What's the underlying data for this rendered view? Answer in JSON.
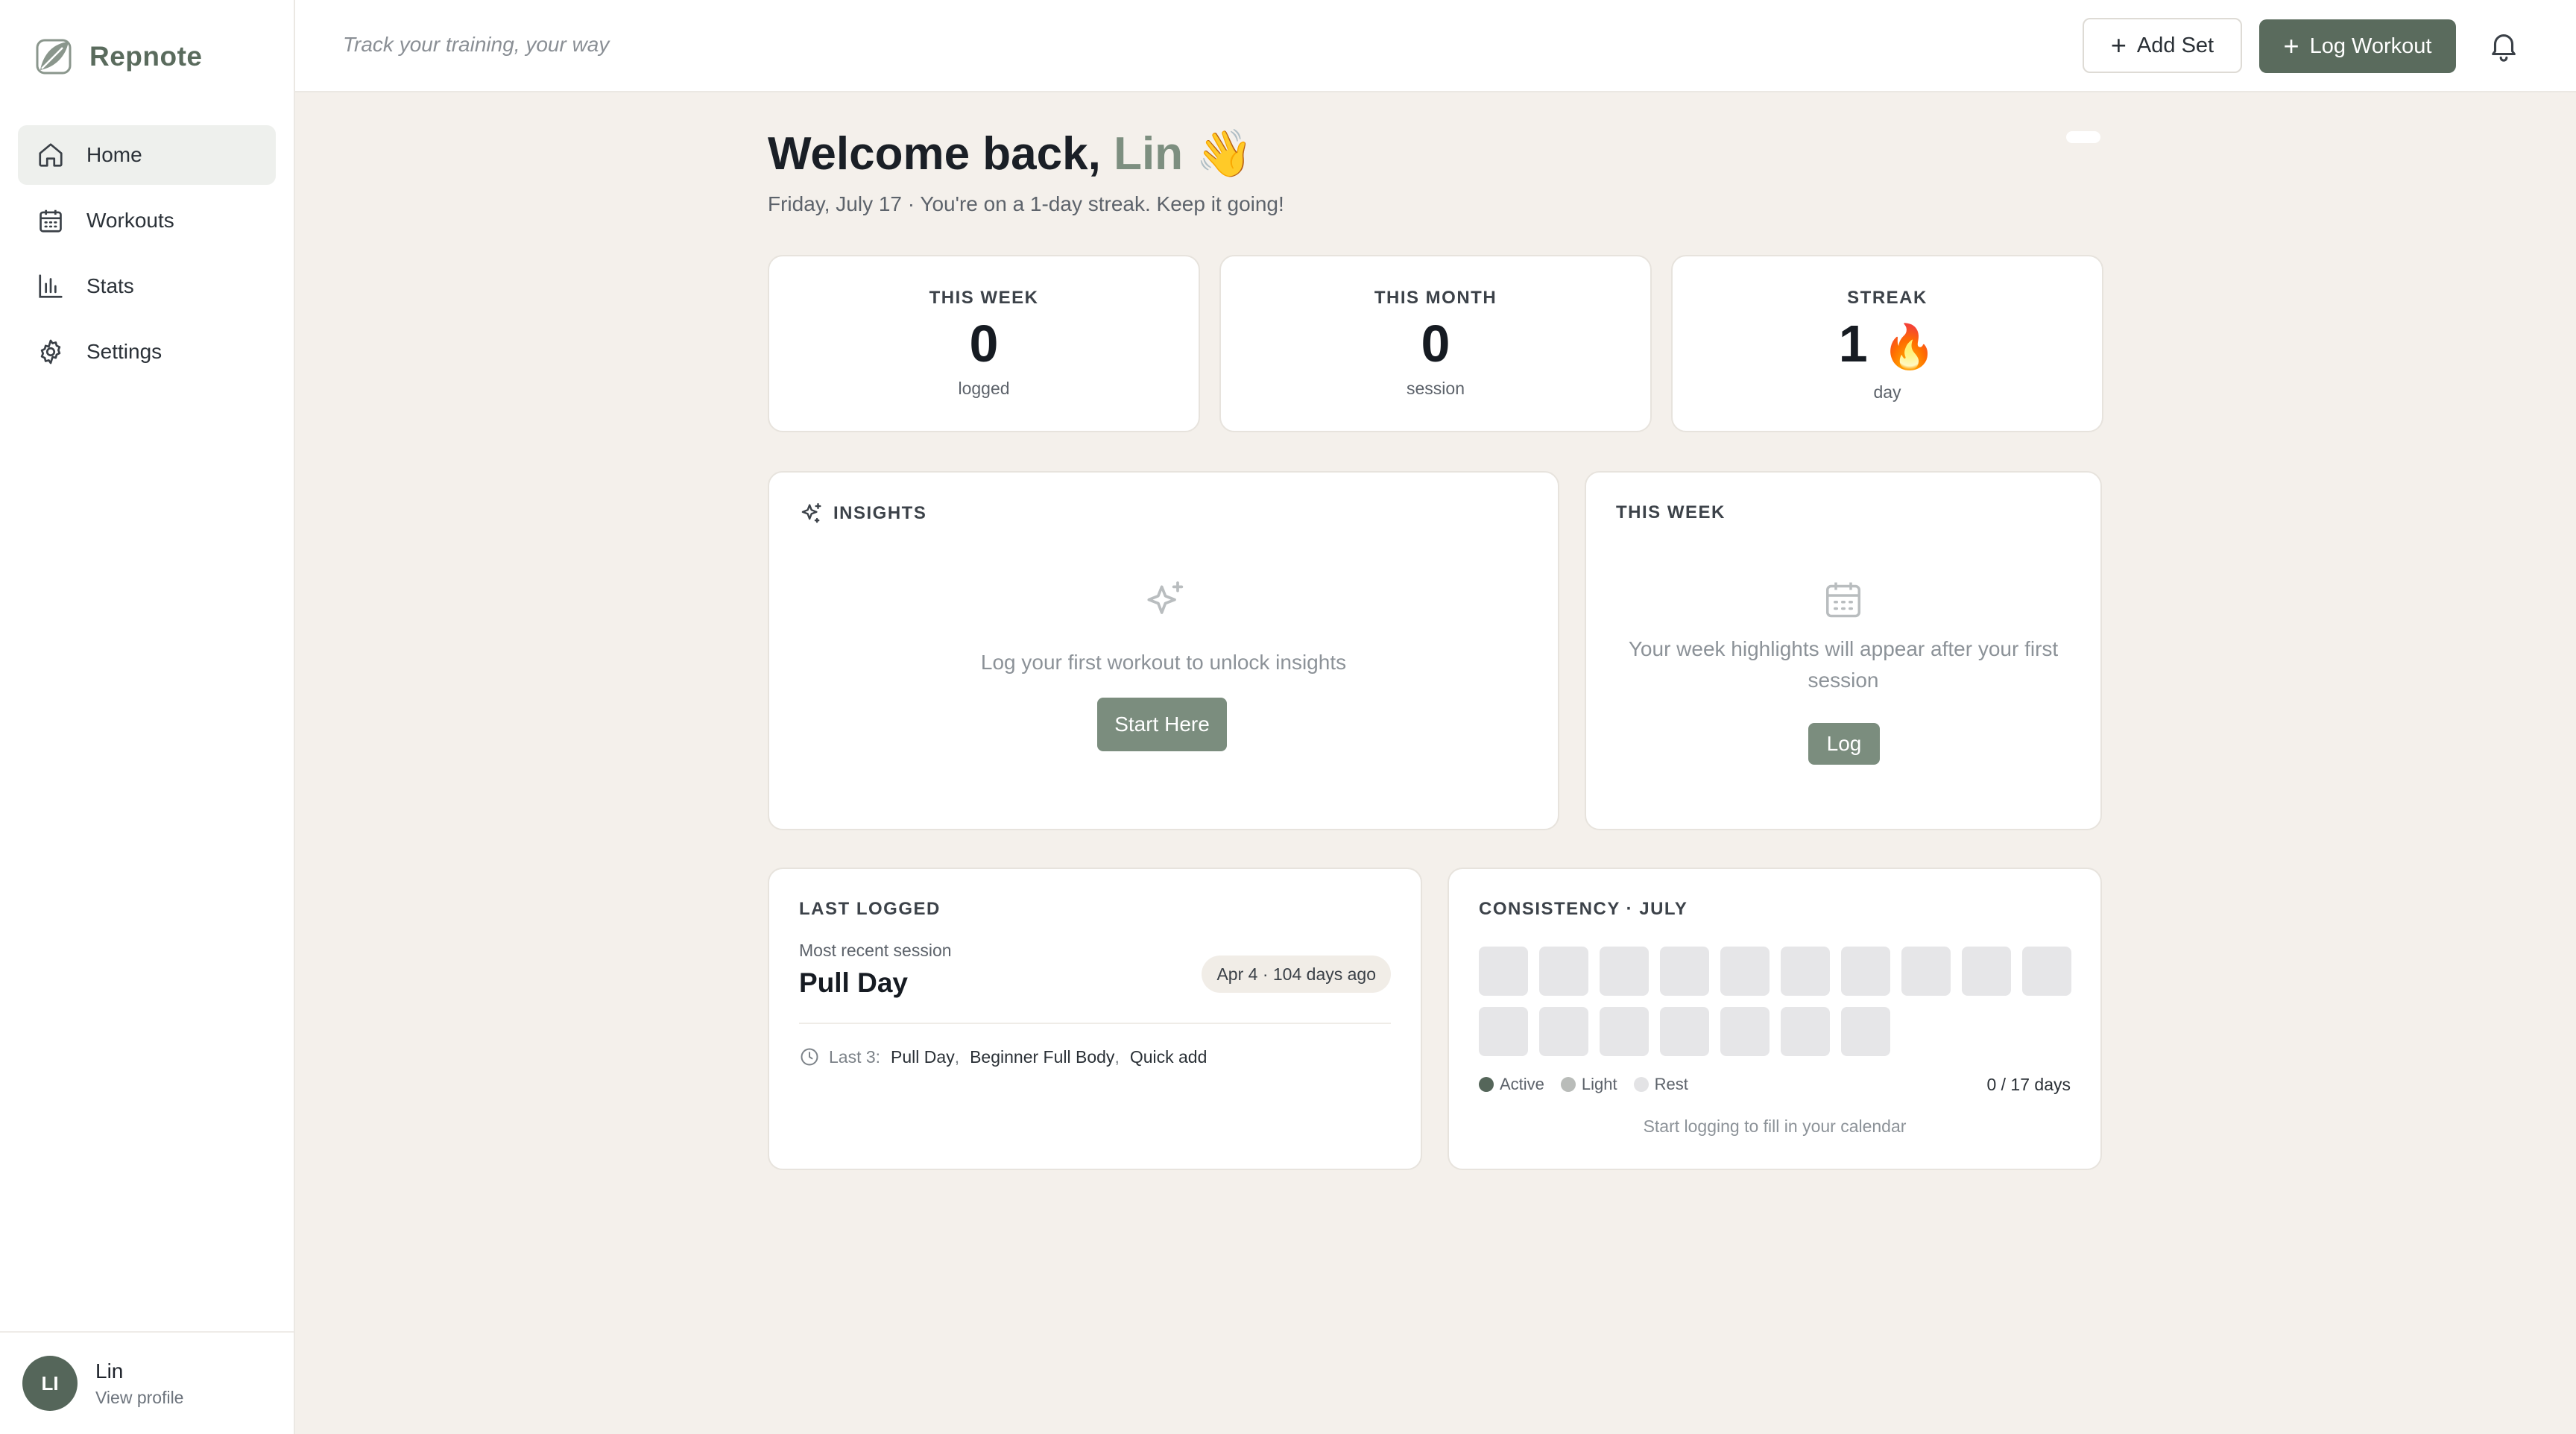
{
  "app": {
    "name": "Repnote"
  },
  "sidebar": {
    "items": [
      {
        "label": "Home",
        "icon": "home-icon",
        "active": true
      },
      {
        "label": "Workouts",
        "icon": "calendar-icon",
        "active": false
      },
      {
        "label": "Stats",
        "icon": "bar-chart-icon",
        "active": false
      },
      {
        "label": "Settings",
        "icon": "gear-icon",
        "active": false
      }
    ],
    "profile": {
      "initials": "LI",
      "name": "Lin",
      "link": "View profile"
    }
  },
  "topbar": {
    "tagline": "Track your training, your way",
    "add_set_label": "Add Set",
    "log_workout_label": "Log Workout"
  },
  "hero": {
    "greeting": "Welcome back,",
    "name": "Lin",
    "emoji": "👋",
    "subtitle": "Friday, July 17 · You're on a 1-day streak. Keep it going!"
  },
  "stats": [
    {
      "label": "THIS WEEK",
      "value": "0",
      "unit": "logged"
    },
    {
      "label": "THIS MONTH",
      "value": "0",
      "unit": "session"
    },
    {
      "label": "STREAK",
      "value": "1",
      "emoji": "🔥",
      "unit": "day"
    }
  ],
  "insights": {
    "title": "INSIGHTS",
    "empty_text": "Log your first workout to unlock insights",
    "button_label": "Start Here"
  },
  "week": {
    "title": "THIS WEEK",
    "empty_text": "Your week highlights will appear after your first session",
    "button_label": "Log"
  },
  "last_logged": {
    "title": "LAST LOGGED",
    "caption": "Most recent session",
    "session_name": "Pull Day",
    "date_badge": "Apr 4 · 104 days ago",
    "recent_label": "Last 3:",
    "recent": [
      "Pull Day",
      "Beginner Full Body",
      "Quick add"
    ]
  },
  "consistency": {
    "title": "CONSISTENCY · JULY",
    "days_total": 17,
    "days_active": 0,
    "legend": [
      {
        "label": "Active",
        "color": "#55665a"
      },
      {
        "label": "Light",
        "color": "#b9bcb9"
      },
      {
        "label": "Rest",
        "color": "#e3e3e5"
      }
    ],
    "summary": "0 / 17 days",
    "footer": "Start logging to fill in your calendar"
  },
  "colors": {
    "accent": "#5a6b5d",
    "accent_light": "#7b8d7e",
    "background": "#f4f0eb"
  }
}
